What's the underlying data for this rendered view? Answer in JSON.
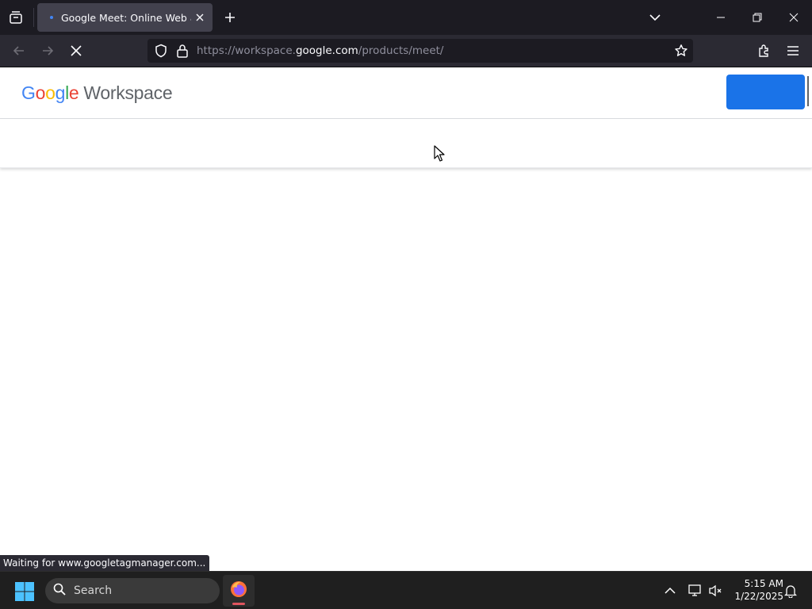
{
  "browser": {
    "tab": {
      "title": "Google Meet: Online Web and Video Conferencing"
    },
    "url": {
      "prefix": "https://workspace.",
      "host": "google.com",
      "path": "/products/meet/"
    },
    "status": "Waiting for www.googletagmanager.com..."
  },
  "site": {
    "logo": {
      "g1": "G",
      "g2": "o",
      "g3": "o",
      "g4": "g",
      "g5": "l",
      "g6": "e",
      "product": "Workspace"
    },
    "brand_colors": {
      "blue": "#4285f4",
      "red": "#ea4335",
      "yellow": "#fbbc05",
      "green": "#34a853",
      "cta": "#1a73e8"
    }
  },
  "taskbar": {
    "search_label": "Search",
    "time": "5:15 AM",
    "date": "1/22/2025"
  },
  "icons": [
    "tab-overview-icon",
    "close-icon",
    "plus-icon",
    "chevron-down-icon",
    "minimize-icon",
    "restore-icon",
    "back-arrow-icon",
    "forward-arrow-icon",
    "stop-loading-icon",
    "shield-icon",
    "lock-icon",
    "star-icon",
    "extensions-icon",
    "hamburger-menu-icon",
    "windows-start-icon",
    "search-icon",
    "firefox-icon",
    "chevron-up-icon",
    "network-icon",
    "volume-muted-icon",
    "bell-icon"
  ]
}
